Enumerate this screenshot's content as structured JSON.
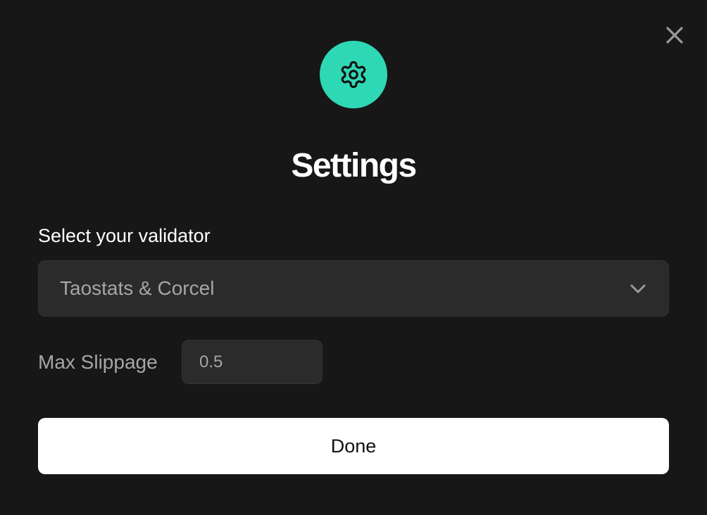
{
  "dialog": {
    "title": "Settings",
    "icon": "gear-icon",
    "close_icon": "close-icon"
  },
  "validator": {
    "label": "Select your validator",
    "selected": "Taostats & Corcel",
    "dropdown_icon": "chevron-down-icon"
  },
  "slippage": {
    "label": "Max Slippage",
    "value": "0.5"
  },
  "actions": {
    "done_label": "Done"
  },
  "colors": {
    "accent": "#2fd8b4",
    "background": "#171717",
    "field": "#2b2b2b",
    "muted_text": "#a6a6a6",
    "button": "#ffffff"
  }
}
